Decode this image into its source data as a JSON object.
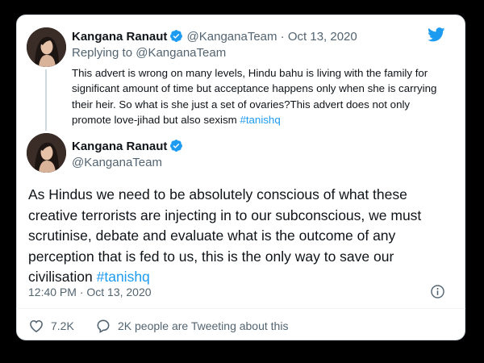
{
  "reply_tweet": {
    "name": "Kangana Ranaut",
    "handle": "@KanganaTeam",
    "separator": "·",
    "date": "Oct 13, 2020",
    "replying_prefix": "Replying to",
    "replying_to": "@KanganaTeam",
    "text": "This advert is wrong on many levels, Hindu bahu is living with the family for significant amount of time but acceptance happens only when she is carrying their heir. So what is she just a set of ovaries?This advert does not only promote love-jihad but also sexism",
    "hashtag": "#tanishq"
  },
  "main_tweet": {
    "name": "Kangana Ranaut",
    "handle": "@KanganaTeam",
    "text": "As Hindus we need to be absolutely conscious of what these creative terrorists are injecting in to our subconscious, we must scrutinise, debate and evaluate what is the outcome of any perception that is fed to us, this is the only way to save our civilisation",
    "hashtag": "#tanishq",
    "timestamp": "12:40 PM · Oct 13, 2020"
  },
  "actions": {
    "likes": "7.2K",
    "conversation": "2K people are Tweeting about this"
  },
  "icons": {
    "brand": "twitter-bird-icon",
    "verified": "verified-badge-icon",
    "info": "info-icon",
    "like": "heart-icon",
    "reply": "speech-bubble-icon"
  },
  "colors": {
    "brand_blue": "#1d9bf0",
    "text": "#0f1419",
    "muted": "#536471",
    "background": "#ffffff",
    "outer_background": "#000000"
  }
}
